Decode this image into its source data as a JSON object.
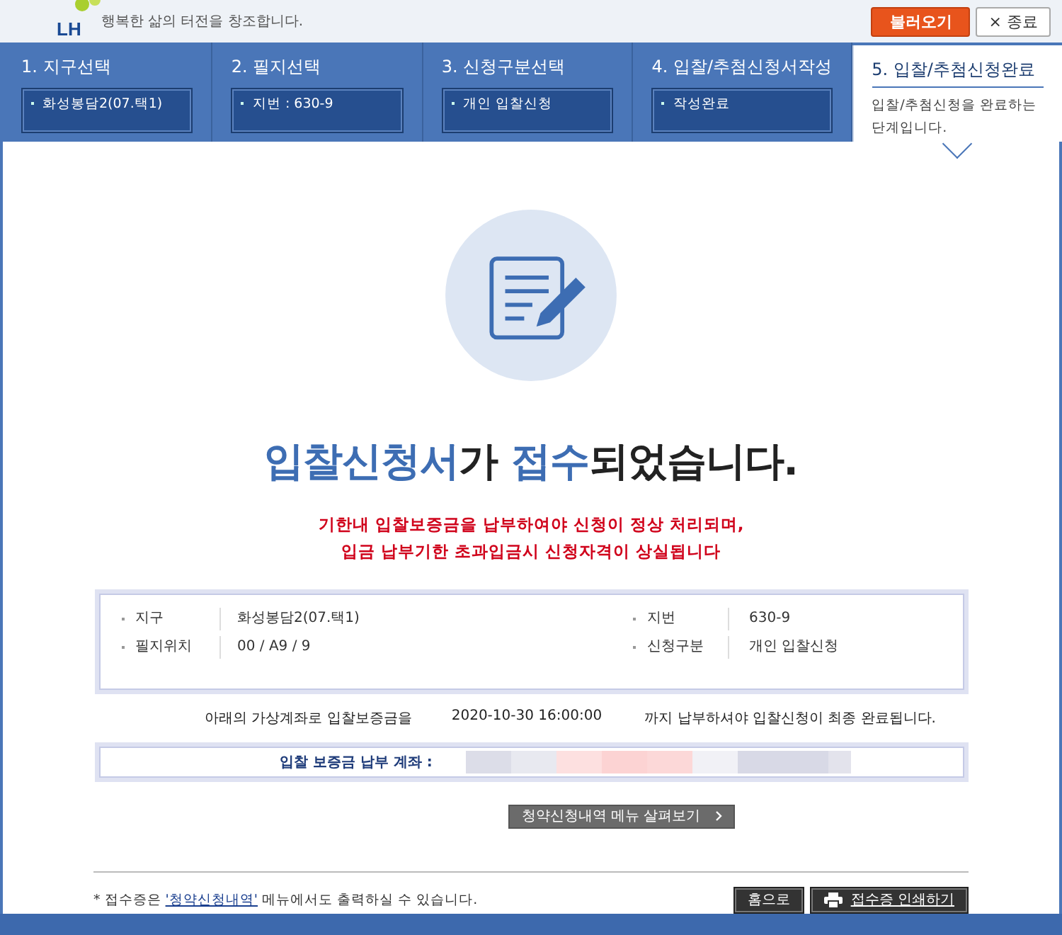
{
  "header": {
    "logo": "LH",
    "tagline": "행복한 삶의 터전을 창조합니다.",
    "buttons": [
      {
        "label": "불러오기",
        "kind": "primary"
      },
      {
        "label": "종료",
        "kind": "close",
        "icon": "×"
      }
    ]
  },
  "steps": [
    {
      "title": "1. 지구선택",
      "detail": "화성봉담2(07.택1)",
      "selected": false
    },
    {
      "title": "2. 필지선택",
      "detail": "지번 : 630-9",
      "selected": false
    },
    {
      "title": "3. 신청구분선택",
      "detail": "개인 입찰신청",
      "selected": false
    },
    {
      "title": "4. 입찰/추첨신청서작성",
      "detail": "작성완료",
      "selected": false
    },
    {
      "title": "5. 입찰/추첨신청완료",
      "detail": "입찰/추첨신청을 완료하는 단계입니다.",
      "selected": true
    }
  ],
  "result": {
    "heading": [
      {
        "text": "입찰신청서",
        "highlight": true
      },
      {
        "text": "가 ",
        "highlight": false
      },
      {
        "text": "접수",
        "highlight": true
      },
      {
        "text": "되었습니다.",
        "highlight": false
      }
    ],
    "warning": [
      "기한내 입찰보증금을 납부하여야 신청이 정상 처리되며,",
      "입금 납부기한 초과입금시 신청자격이 상실됩니다"
    ]
  },
  "info": [
    {
      "label": "지구",
      "value": "화성봉담2(07.택1)"
    },
    {
      "label": "지번",
      "value": "630-9"
    },
    {
      "label": "필지위치",
      "value": "00 / A9 / 9"
    },
    {
      "label": "신청구분",
      "value": "개인 입찰신청"
    }
  ],
  "deadline": {
    "before": "아래의 가상계좌로 입찰보증금을",
    "date": "2020-10-30 16:00:00",
    "after": "까지 납부하셔야 입찰신청이 최종 완료됩니다."
  },
  "account": {
    "label": "입찰 보증금 납부 계좌 :"
  },
  "menu_button": "청약신청내역 메뉴 살펴보기",
  "footer": {
    "note_before": "* 접수증은 ",
    "link": "'청약신청내역'",
    "note_after": " 메뉴에서도 출력하실 수 있습니다.",
    "buttons": [
      {
        "label": "홈으로",
        "kind": "plain"
      },
      {
        "label": "접수증 인쇄하기",
        "kind": "print"
      }
    ]
  }
}
